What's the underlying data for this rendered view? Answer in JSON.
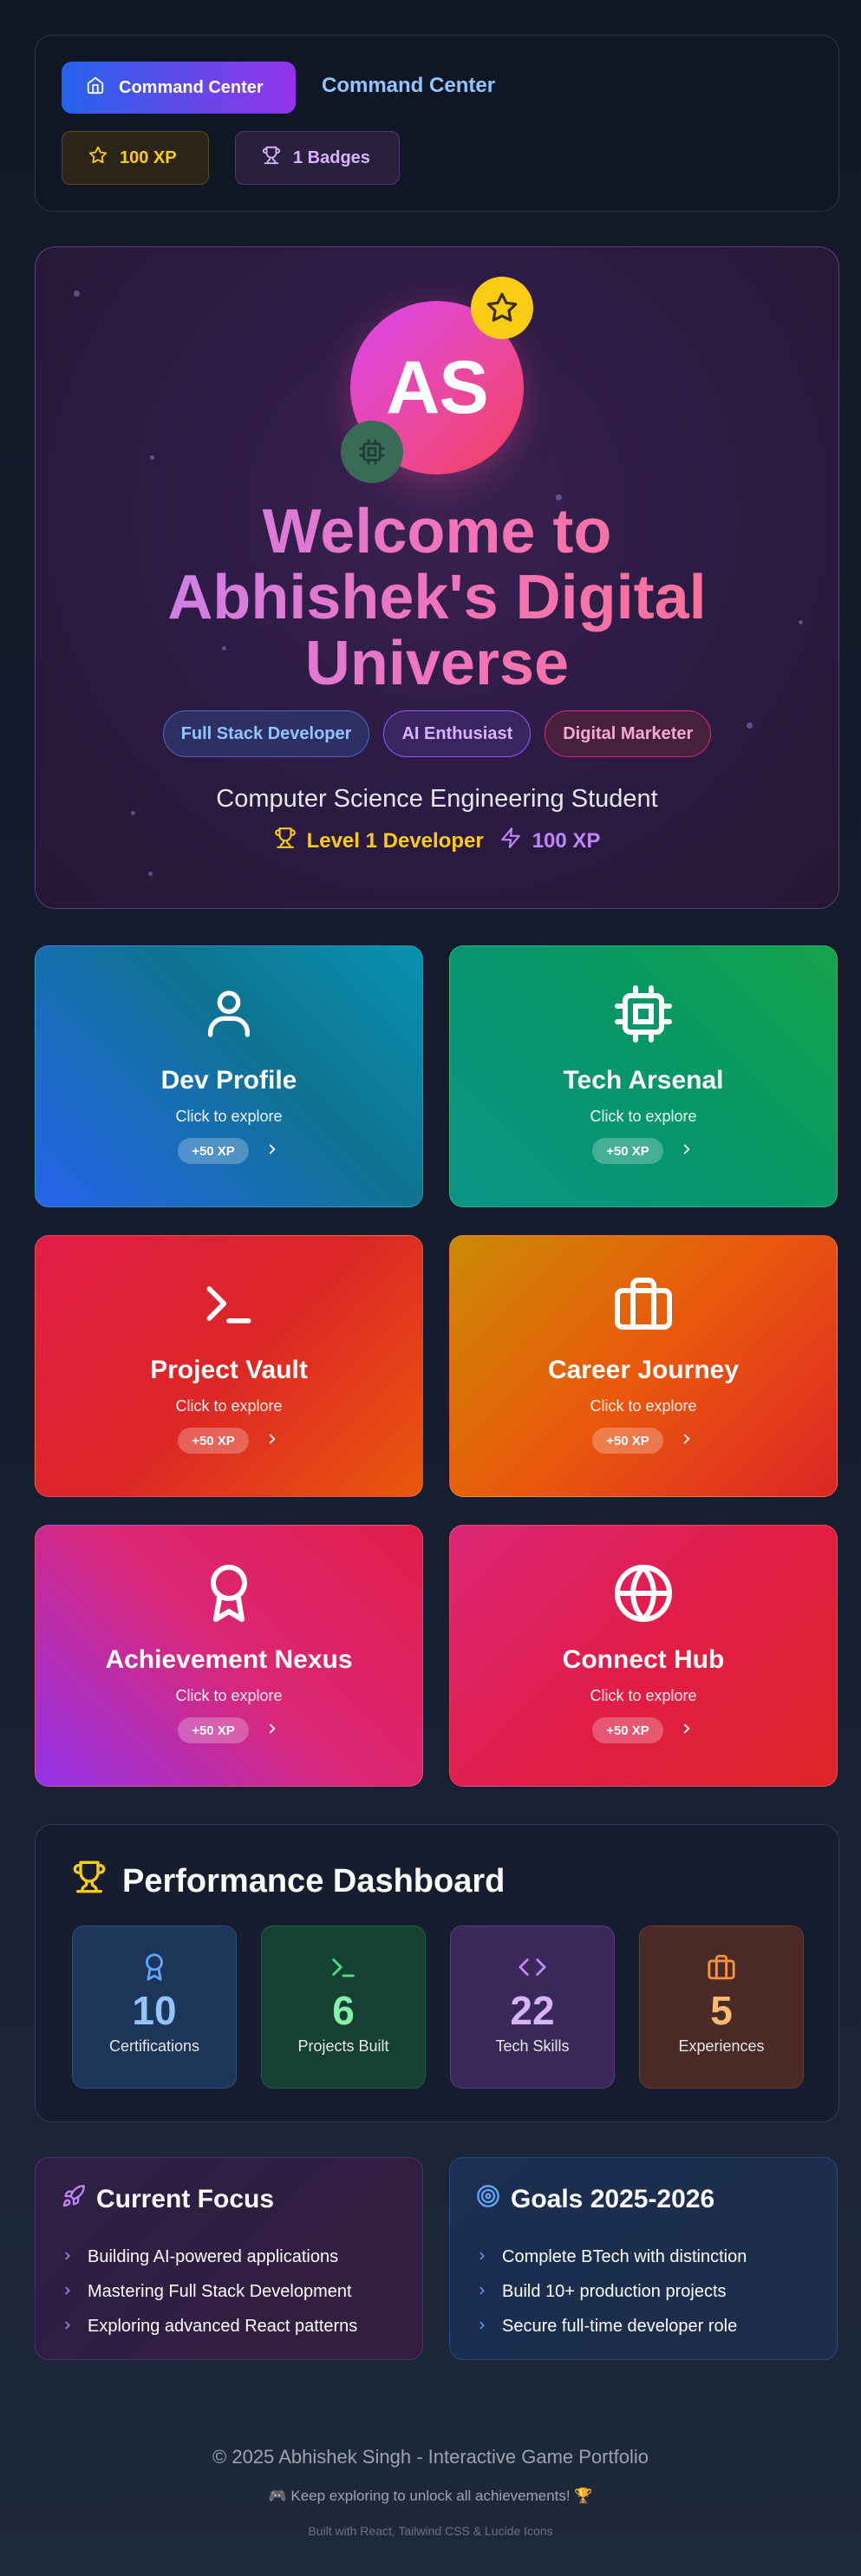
{
  "header": {
    "command_button_label": "Command Center",
    "title": "Command Center",
    "xp_label": "100 XP",
    "badges_label": "1 Badges"
  },
  "hero": {
    "avatar_initials": "AS",
    "welcome_line1": "Welcome to",
    "welcome_line2": "Abhishek's Digital",
    "welcome_line3": "Universe",
    "roles": [
      "Full Stack Developer",
      "AI Enthusiast",
      "Digital Marketer"
    ],
    "subtitle": "Computer Science Engineering Student",
    "level": "Level 1 Developer",
    "xp": "100 XP"
  },
  "cards": [
    {
      "title": "Dev Profile",
      "subtitle": "Click to explore",
      "xp": "+50 XP",
      "icon": "user-icon"
    },
    {
      "title": "Tech Arsenal",
      "subtitle": "Click to explore",
      "xp": "+50 XP",
      "icon": "cpu-icon"
    },
    {
      "title": "Project Vault",
      "subtitle": "Click to explore",
      "xp": "+50 XP",
      "icon": "terminal-icon"
    },
    {
      "title": "Career Journey",
      "subtitle": "Click to explore",
      "xp": "+50 XP",
      "icon": "briefcase-icon"
    },
    {
      "title": "Achievement Nexus",
      "subtitle": "Click to explore",
      "xp": "+50 XP",
      "icon": "award-icon"
    },
    {
      "title": "Connect Hub",
      "subtitle": "Click to explore",
      "xp": "+50 XP",
      "icon": "globe-icon"
    }
  ],
  "performance": {
    "title": "Performance Dashboard",
    "stats": [
      {
        "value": "10",
        "label": "Certifications",
        "color": "#93c5fd"
      },
      {
        "value": "6",
        "label": "Projects Built",
        "color": "#86efac"
      },
      {
        "value": "22",
        "label": "Tech Skills",
        "color": "#d8b4fe"
      },
      {
        "value": "5",
        "label": "Experiences",
        "color": "#fdba74"
      }
    ]
  },
  "focus": {
    "title": "Current Focus",
    "items": [
      "Building AI-powered applications",
      "Mastering Full Stack Development",
      "Exploring advanced React patterns"
    ]
  },
  "goals": {
    "title": "Goals 2025-2026",
    "items": [
      "Complete BTech with distinction",
      "Build 10+ production projects",
      "Secure full-time developer role"
    ]
  },
  "footer": {
    "copyright": "© 2025 Abhishek Singh - Interactive Game Portfolio",
    "tagline": "🎮 Keep exploring to unlock all achievements! 🏆",
    "built_with": "Built with React, Tailwind CSS & Lucide Icons"
  }
}
